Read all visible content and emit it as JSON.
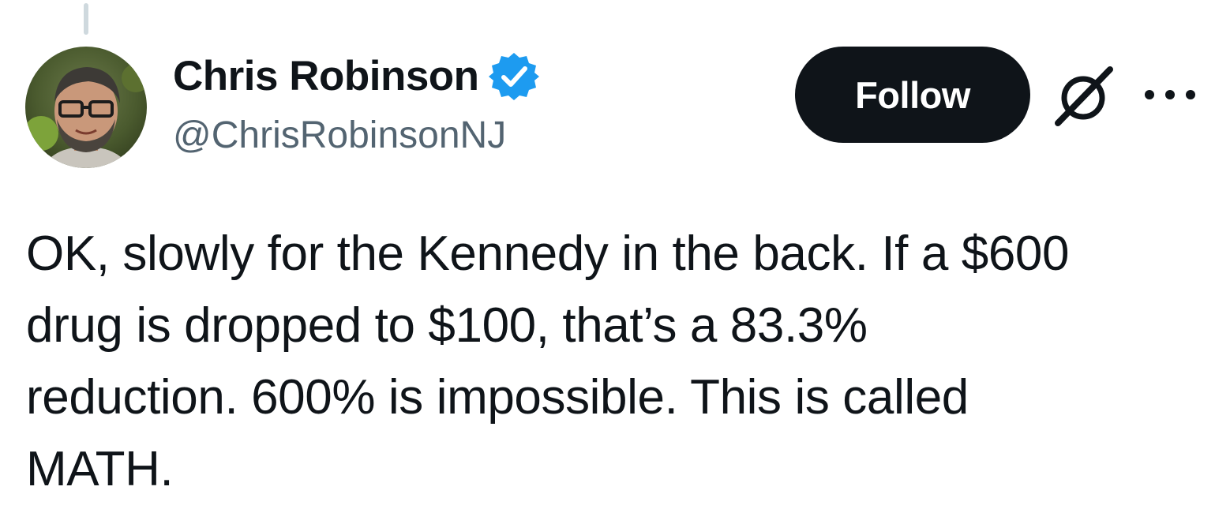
{
  "tweet": {
    "author": {
      "display_name": "Chris Robinson",
      "handle": "@ChrisRobinsonNJ",
      "verified": true,
      "avatar_icon": "profile-photo"
    },
    "follow_label": "Follow",
    "icons": {
      "grok": "grok-icon",
      "more": "more-options-icon",
      "verified": "verified-badge-icon"
    },
    "text": "OK, slowly for the Kennedy in the back. If a $600\ndrug is dropped to $100, that’s a 83.3%\nreduction. 600% is impossible. This is called\nMATH."
  },
  "colors": {
    "follow_background": "#0f1419",
    "follow_text": "#ffffff",
    "verified_blue": "#1d9bf0",
    "handle_gray": "#536471",
    "primary_text": "#0f1419"
  }
}
